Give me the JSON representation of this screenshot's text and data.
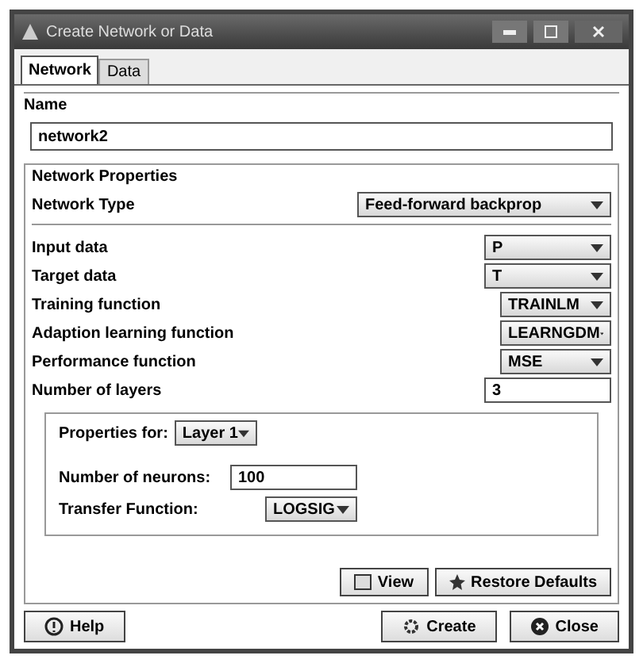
{
  "window": {
    "title": "Create Network or Data"
  },
  "tabs": [
    {
      "label": "Network",
      "selected": true
    },
    {
      "label": "Data",
      "selected": false
    }
  ],
  "name_section": {
    "title": "Name",
    "value": "network2"
  },
  "network_properties": {
    "title": "Network Properties",
    "network_type": {
      "label": "Network Type",
      "value": "Feed-forward backprop"
    },
    "fields": [
      {
        "kind": "dropdown",
        "label": "Input data",
        "value": "P"
      },
      {
        "kind": "dropdown",
        "label": "Target data",
        "value": "T"
      },
      {
        "kind": "dropdown",
        "label": "Training function",
        "value": "TRAINLM"
      },
      {
        "kind": "dropdown",
        "label": "Adaption learning function",
        "value": "LEARNGDM"
      },
      {
        "kind": "dropdown",
        "label": "Performance function",
        "value": "MSE"
      },
      {
        "kind": "text",
        "label": "Number of layers",
        "value": "3"
      }
    ],
    "layer_properties": {
      "label": "Properties for:",
      "layer": "Layer 1",
      "fields": [
        {
          "kind": "text",
          "label": "Number of neurons:",
          "value": "100"
        },
        {
          "kind": "dropdown",
          "label": "Transfer Function:",
          "value": "LOGSIG"
        }
      ]
    },
    "buttons": [
      "View",
      "Restore Defaults"
    ]
  },
  "footer_buttons": [
    {
      "kind": "help",
      "label": "Help"
    },
    {
      "kind": "create",
      "label": "Create"
    },
    {
      "kind": "close",
      "label": "Close"
    }
  ]
}
